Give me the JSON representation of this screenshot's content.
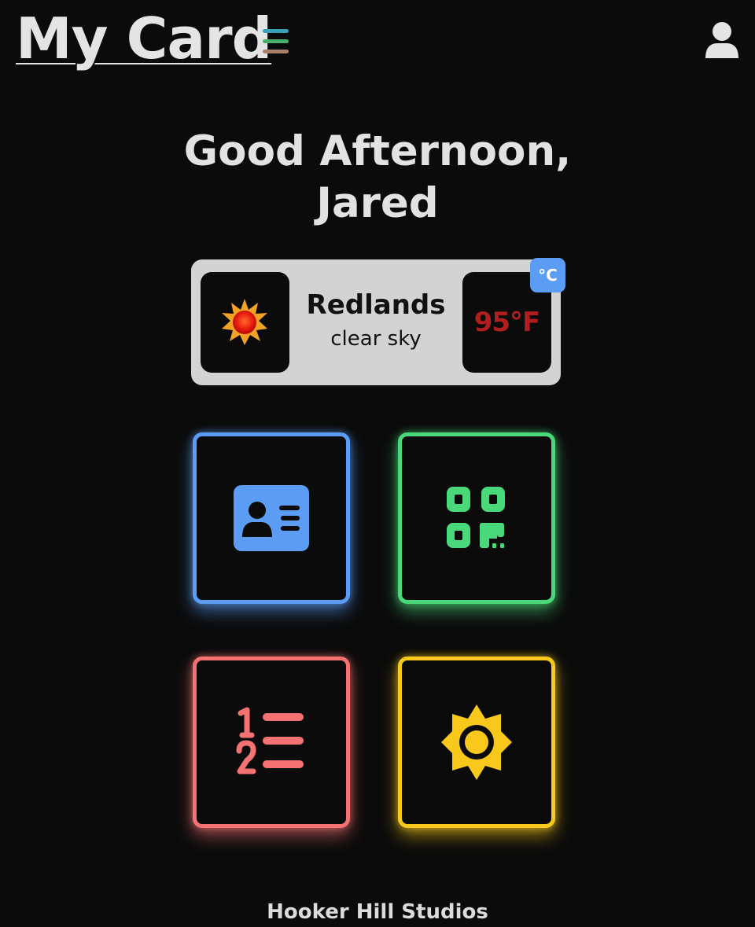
{
  "header": {
    "title": "My Card",
    "menu_icon": "hamburger-icon",
    "menu_colors": [
      "#3aa0b8",
      "#4cae6a",
      "#a8806a"
    ],
    "user_icon": "user-icon"
  },
  "greeting": {
    "line1": "Good Afternoon,",
    "line2": "Jared"
  },
  "weather": {
    "icon": "sun-icon",
    "city": "Redlands",
    "condition": "clear sky",
    "temperature": "95°F",
    "unit_toggle_label": "°C"
  },
  "tiles": [
    {
      "name": "id-card",
      "icon": "id-card-icon",
      "color": "#5b9df5"
    },
    {
      "name": "qr-code",
      "icon": "qr-code-icon",
      "color": "#4ad97a"
    },
    {
      "name": "numbered-list",
      "icon": "numbered-list-icon",
      "color": "#f57272"
    },
    {
      "name": "brightness",
      "icon": "sun-icon",
      "color": "#f8c81a"
    }
  ],
  "footer": {
    "text": "Hooker Hill Studios"
  }
}
